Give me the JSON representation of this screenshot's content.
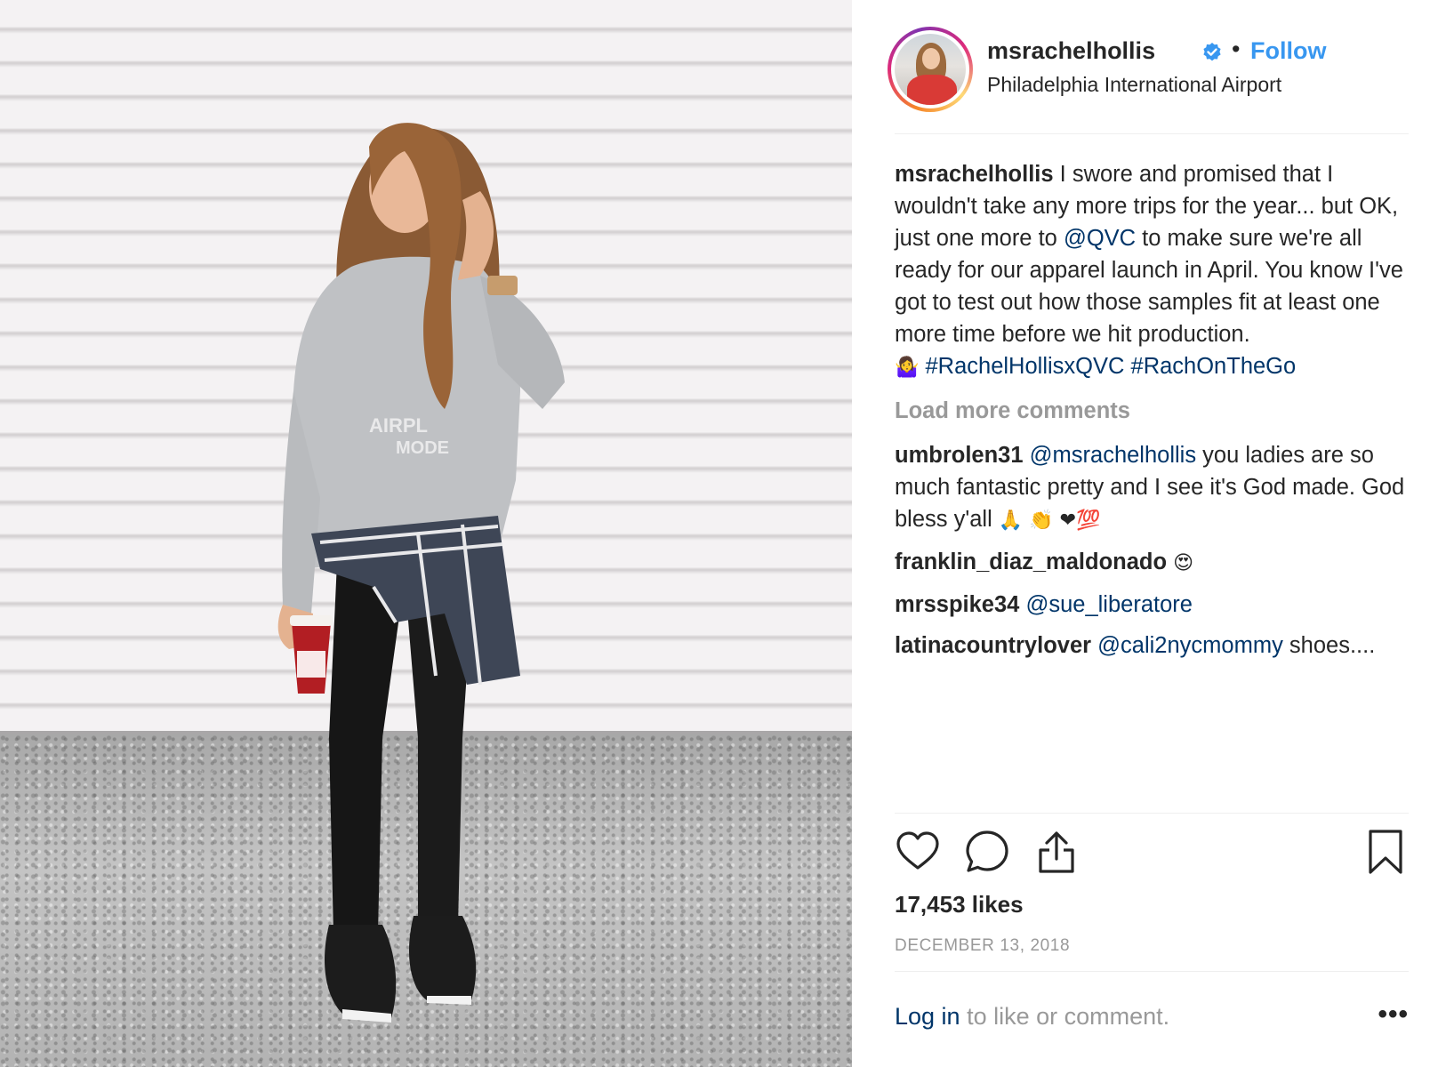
{
  "post": {
    "username": "msrachelhollis",
    "follow_label": "Follow",
    "separator": "•",
    "location": "Philadelphia International Airport",
    "caption": {
      "username": "msrachelhollis",
      "text_1": " I swore and promised that I wouldn't take any more trips for the year... but OK, just one more to ",
      "mention": "@QVC",
      "text_2": " to make sure we're all ready for our apparel launch in April. You know I've got to test out how those samples fit at least one more time before we hit production.",
      "emoji": "🤷‍♀️",
      "hashtag_1": "#RachelHollisxQVC",
      "hashtag_2": "#RachOnTheGo"
    },
    "load_more_label": "Load more comments",
    "comments": [
      {
        "username": "umbrolen31",
        "mention": "@msrachelhollis",
        "text": " you ladies are so much fantastic pretty and I see it's God made. God bless y'all ",
        "emoji": "🙏 👏 ❤💯"
      },
      {
        "username": "franklin_diaz_maldonado",
        "mention": "",
        "text": " ",
        "emoji": "😍"
      },
      {
        "username": "mrsspike34",
        "mention": "@sue_liberatore",
        "text": "",
        "emoji": ""
      },
      {
        "username": "latinacountrylover",
        "mention": "@cali2nycmommy",
        "text": " shoes....",
        "emoji": ""
      }
    ],
    "likes": "17,453 likes",
    "date": "DECEMBER 13, 2018",
    "footer": {
      "login_label": "Log in",
      "rest_text": " to like or comment.",
      "more_label": "•••"
    },
    "photo": {
      "shirt_text_1": "AIRPL",
      "shirt_text_2": "MODE"
    }
  },
  "icons": [
    "verified-badge-icon",
    "heart-icon",
    "comment-icon",
    "share-icon",
    "bookmark-icon",
    "more-options-icon"
  ],
  "colors": {
    "link_blue": "#3897f0",
    "mention_blue": "#003569",
    "muted": "#999999",
    "text": "#262626"
  }
}
